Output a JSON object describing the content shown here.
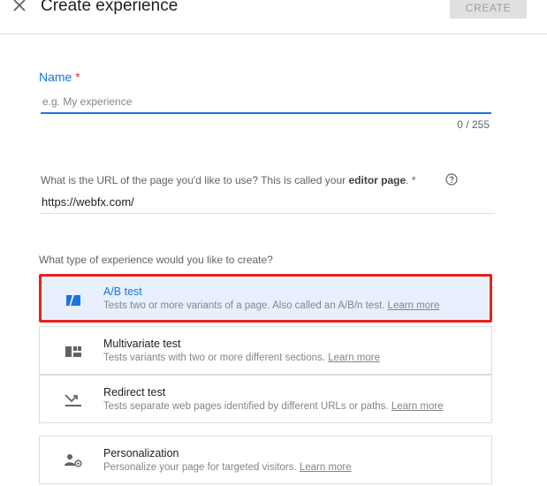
{
  "header": {
    "title": "Create experience",
    "create_label": "CREATE"
  },
  "name_field": {
    "label": "Name",
    "required_mark": "*",
    "placeholder": "e.g. My experience",
    "value": "",
    "counter": "0 / 255"
  },
  "url_field": {
    "label_prefix": "What is the URL of the page you'd like to use? This is called your ",
    "label_bold": "editor page",
    "label_suffix": ". *",
    "value": "https://webfx.com/"
  },
  "type_question": "What type of experience would you like to create?",
  "options": [
    {
      "title": "A/B test",
      "description": "Tests two or more variants of a page. Also called an A/B/n test.",
      "learn_more": "Learn more",
      "icon": "ab-test-icon",
      "selected": true
    },
    {
      "title": "Multivariate test",
      "description": "Tests variants with two or more different sections.",
      "learn_more": "Learn more",
      "icon": "multivariate-icon",
      "selected": false
    },
    {
      "title": "Redirect test",
      "description": "Tests separate web pages identified by different URLs or paths.",
      "learn_more": "Learn more",
      "icon": "redirect-icon",
      "selected": false
    },
    {
      "title": "Personalization",
      "description": "Personalize your page for targeted visitors.",
      "learn_more": "Learn more",
      "icon": "personalization-icon",
      "selected": false
    }
  ],
  "colors": {
    "accent": "#1a73e8",
    "required": "#d93025",
    "highlight_border": "#e8201c",
    "selected_bg": "#e8f0fe"
  }
}
